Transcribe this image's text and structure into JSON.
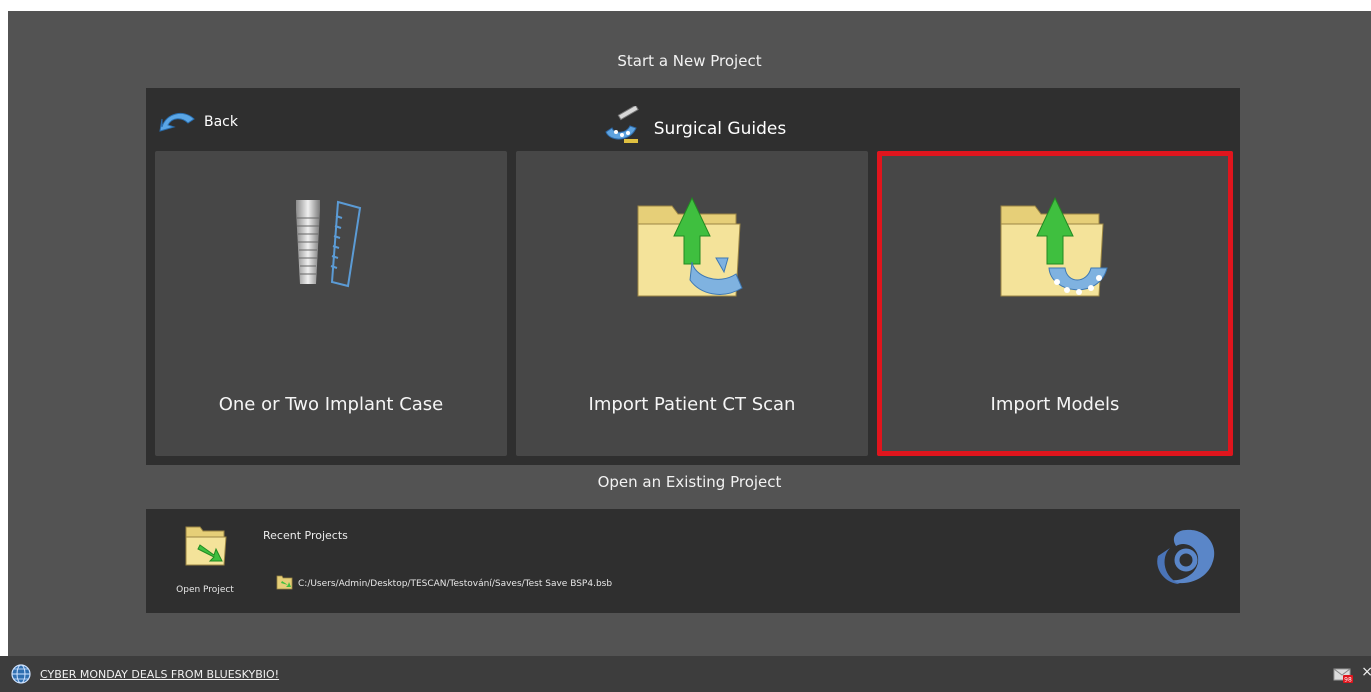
{
  "headings": {
    "start_new": "Start a New Project",
    "open_existing": "Open an Existing Project"
  },
  "nav": {
    "back_label": "Back"
  },
  "guides": {
    "title": "Surgical Guides",
    "icon": "surgical-guide-icon"
  },
  "tiles": [
    {
      "label": "One or Two Implant Case",
      "icon": "implant-icon",
      "selected": false
    },
    {
      "label": "Import Patient CT Scan",
      "icon": "folder-upload-jaw-icon",
      "selected": false
    },
    {
      "label": "Import Models",
      "icon": "folder-upload-model-icon",
      "selected": true
    }
  ],
  "open_project": {
    "label": "Open Project",
    "recent_title": "Recent Projects",
    "recent_items": [
      {
        "path": "C:/Users/Admin/Desktop/TESCAN/Testování/Saves/Test Save BSP4.bsb"
      }
    ]
  },
  "status_bar": {
    "promo_text": "CYBER MONDAY DEALS FROM BLUESKYBIO!",
    "mail_badge": "98",
    "close_glyph": "×"
  },
  "colors": {
    "background": "#535353",
    "panel": "#2f2f2f",
    "tile": "#474747",
    "selection_outline": "#e0151d",
    "accent_green": "#3fbf3f",
    "accent_blue": "#5b9bd5"
  }
}
